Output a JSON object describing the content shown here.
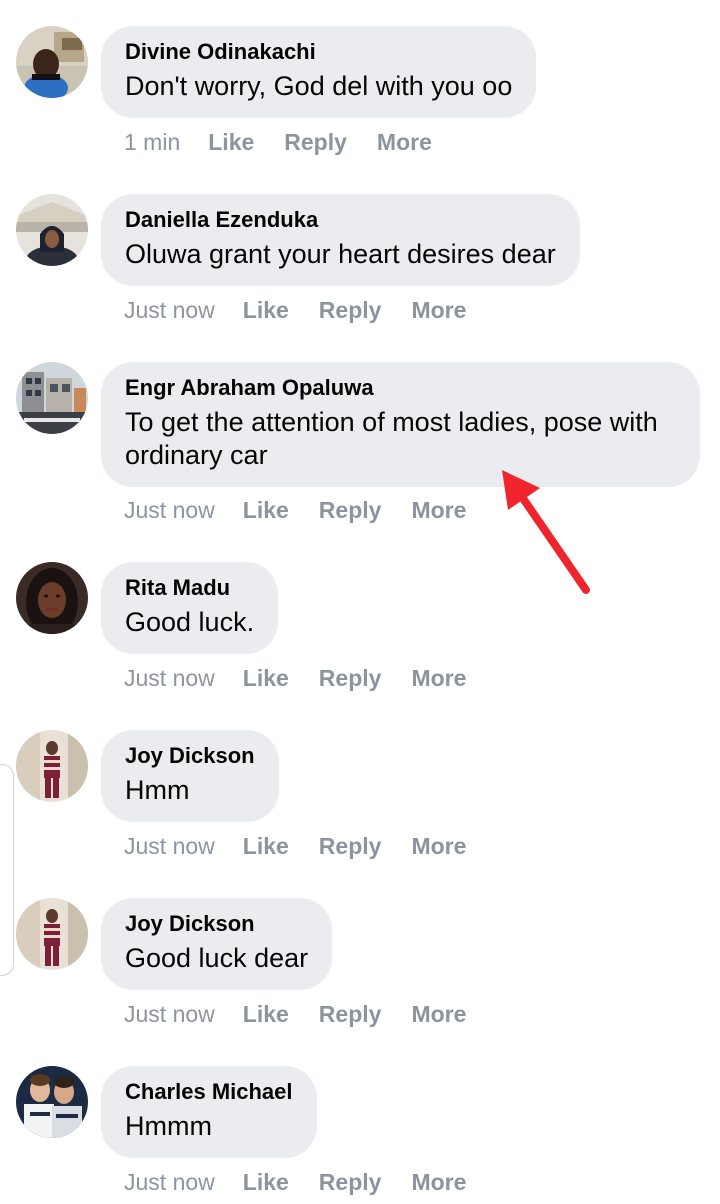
{
  "comments": [
    {
      "author": "Divine Odinakachi",
      "text": "Don't worry, God del with you oo",
      "time": "1 min",
      "avatar_icon": "avatar-divine-odinakachi"
    },
    {
      "author": "Daniella Ezenduka",
      "text": "Oluwa grant your heart desires dear",
      "time": "Just now",
      "avatar_icon": "avatar-daniella-ezenduka"
    },
    {
      "author": "Engr Abraham Opaluwa",
      "text": "To get the attention of most ladies, pose with ordinary car",
      "time": "Just now",
      "avatar_icon": "avatar-engr-abraham-opaluwa"
    },
    {
      "author": "Rita Madu",
      "text": "Good luck.",
      "time": "Just now",
      "avatar_icon": "avatar-rita-madu"
    },
    {
      "author": "Joy Dickson",
      "text": "Hmm",
      "time": "Just now",
      "avatar_icon": "avatar-joy-dickson"
    },
    {
      "author": "Joy Dickson",
      "text": "Good luck dear",
      "time": "Just now",
      "avatar_icon": "avatar-joy-dickson"
    },
    {
      "author": "Charles Michael",
      "text": "Hmmm",
      "time": "Just now",
      "avatar_icon": "avatar-charles-michael"
    }
  ],
  "actions": {
    "like": "Like",
    "reply": "Reply",
    "more": "More"
  },
  "colors": {
    "bubble": "#ebecf0",
    "author_text": "#050505",
    "action_text": "#8d949e",
    "annotation_arrow": "#f0242c"
  },
  "annotation": {
    "icon": "red-arrow-icon"
  }
}
